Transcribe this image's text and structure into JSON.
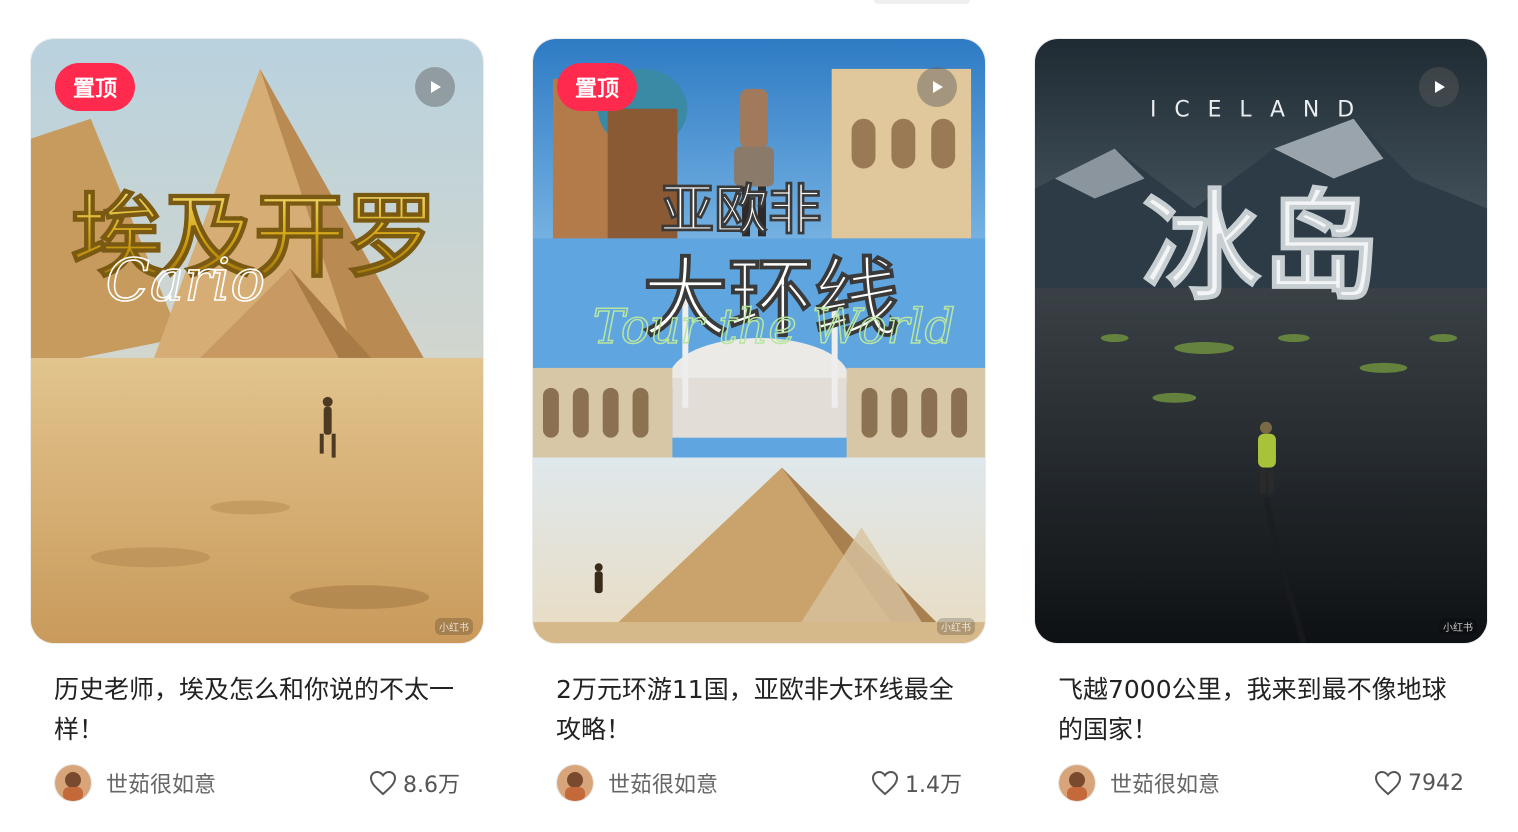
{
  "badge_label": "置顶",
  "posts": [
    {
      "pinned": true,
      "cover_title": "埃及开罗",
      "cover_script": "Cario",
      "title": "历史老师，埃及怎么和你说的不太一样！",
      "author": "世茹很如意",
      "likes": "8.6万"
    },
    {
      "pinned": true,
      "cover_title_line1": "亚欧非",
      "cover_title_line2": "大环线",
      "cover_script": "Tour the World",
      "title": "2万元环游11国，亚欧非大环线最全攻略！",
      "author": "世茹很如意",
      "likes": "1.4万"
    },
    {
      "pinned": false,
      "cover_kicker": "ICELAND",
      "cover_title": "冰岛",
      "title": "飞越7000公里，我来到最不像地球的国家！",
      "author": "世茹很如意",
      "likes": "7942"
    }
  ],
  "icons": {
    "play": "play-icon",
    "heart": "heart-icon"
  },
  "colors": {
    "badge": "#ff2a4d",
    "title_text": "#222222",
    "meta_text": "#666666"
  }
}
